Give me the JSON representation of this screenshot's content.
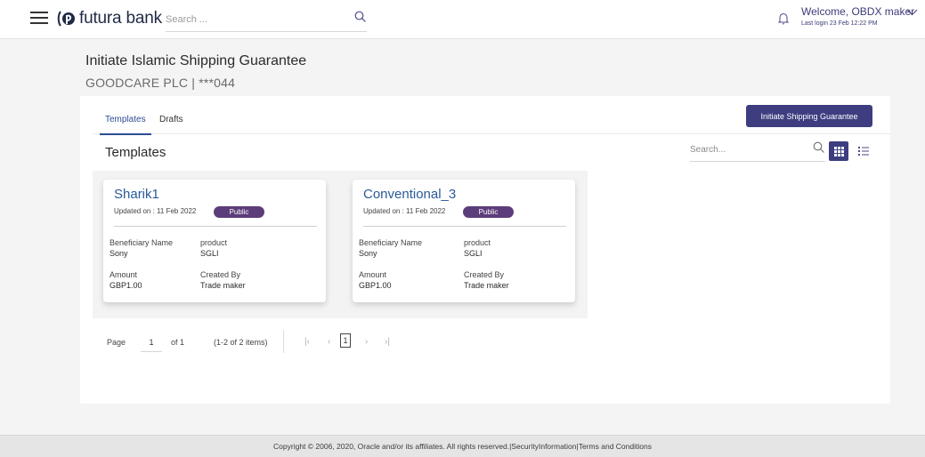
{
  "header": {
    "brand": "futura bank",
    "search_placeholder": "Search ...",
    "welcome": "Welcome, OBDX maker",
    "last_login": "Last login 23 Feb 12:22 PM"
  },
  "page": {
    "title": "Initiate Islamic Shipping Guarantee",
    "subtitle": "GOODCARE PLC | ***044"
  },
  "tabs": [
    {
      "label": "Templates",
      "active": true
    },
    {
      "label": "Drafts",
      "active": false
    }
  ],
  "actions": {
    "initiate": "Initiate Shipping Guarantee"
  },
  "templates": {
    "section_title": "Templates",
    "search_placeholder": "Search...",
    "cards": [
      {
        "name": "Sharik1",
        "updated": "Updated on : 11 Feb 2022",
        "badge": "Public",
        "beneficiary_label": "Beneficiary Name",
        "beneficiary": "Sony",
        "product_label": "product",
        "product": "SGLI",
        "amount_label": "Amount",
        "amount": "GBP1.00",
        "created_label": "Created By",
        "created_by": "Trade maker"
      },
      {
        "name": "Conventional_3",
        "updated": "Updated on : 11 Feb 2022",
        "badge": "Public",
        "beneficiary_label": "Beneficiary Name",
        "beneficiary": "Sony",
        "product_label": "product",
        "product": "SGLI",
        "amount_label": "Amount",
        "amount": "GBP1.00",
        "created_label": "Created By",
        "created_by": "Trade maker"
      }
    ]
  },
  "pagination": {
    "page_label": "Page",
    "page": "1",
    "of": "of 1",
    "items": "(1-2 of 2 items)",
    "first": "|‹",
    "prev": "‹",
    "current": "1",
    "next": "›",
    "last": "›|"
  },
  "footer": {
    "copyright": "Copyright © 2006, 2020, Oracle and/or its affiliates. All rights reserved.",
    "security": "SecurityInformation",
    "terms": "Terms and Conditions"
  },
  "colors": {
    "primary": "#3d3d80",
    "badge": "#5c3c7a",
    "link": "#2a5a9a"
  }
}
